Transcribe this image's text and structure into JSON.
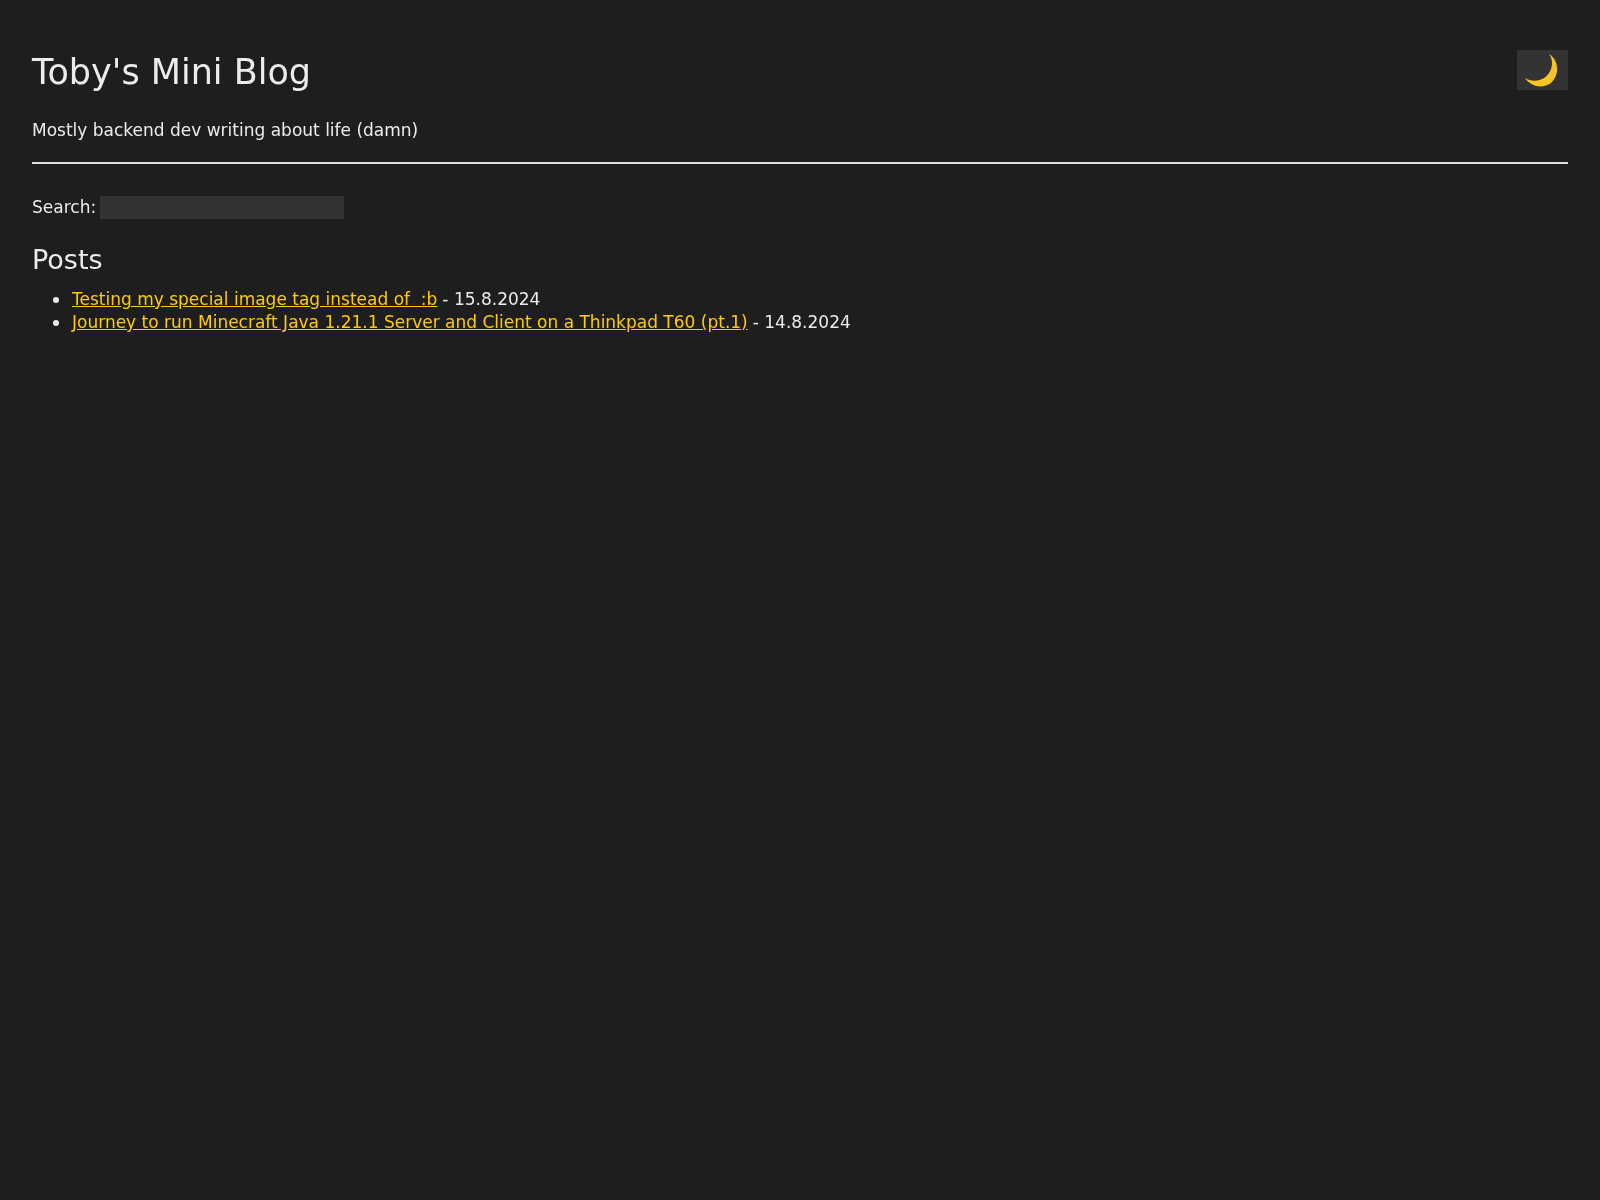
{
  "header": {
    "title": "Toby's Mini Blog",
    "subtitle": "Mostly backend dev writing about life (damn)"
  },
  "theme_toggle": {
    "dark": true
  },
  "search": {
    "label": "Search:"
  },
  "posts_heading": "Posts",
  "posts": [
    {
      "title": "Testing my special image tag instead of  :b",
      "date": "- 15.8.2024"
    },
    {
      "title": "Journey to run Minecraft Java 1.21.1 Server and Client on a Thinkpad T60 (pt.1)",
      "date": "- 14.8.2024"
    }
  ]
}
